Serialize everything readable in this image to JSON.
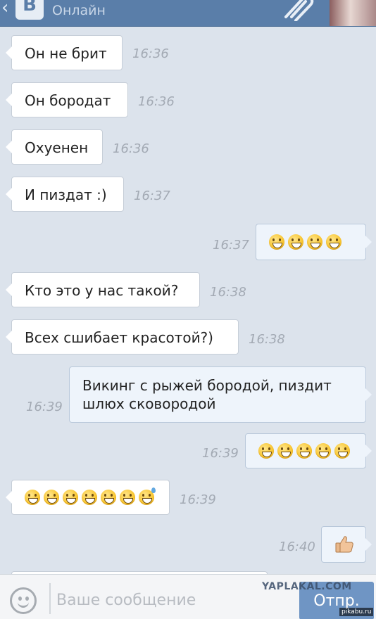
{
  "header": {
    "logo_letter": "В",
    "status": "Онлайн"
  },
  "messages": [
    {
      "direction": "in",
      "text": "Он не брит",
      "time": "16:36"
    },
    {
      "direction": "in",
      "text": "Он бородат",
      "time": "16:36"
    },
    {
      "direction": "in",
      "text": "Охуенен",
      "time": "16:36"
    },
    {
      "direction": "in",
      "text": "И пиздат :)",
      "time": "16:37"
    },
    {
      "direction": "out",
      "emoji": "😄😄😄😄",
      "time": "16:37"
    },
    {
      "direction": "in",
      "text": "Кто это у нас такой?",
      "time": "16:38"
    },
    {
      "direction": "in",
      "text": "Всех сшибает красотой?)",
      "time": "16:38"
    },
    {
      "direction": "out",
      "text_line1": "Викинг с рыжей бородой, пиздит",
      "text_line2": "шлюх сковородой",
      "time": "16:39"
    },
    {
      "direction": "out",
      "emoji": "😄😄😄😄😄",
      "time": "16:39"
    },
    {
      "direction": "in",
      "emoji": "😄😄😄😄😄😄😅",
      "time": "16:39"
    },
    {
      "direction": "out",
      "emoji": "👍",
      "time": "16:40"
    }
  ],
  "composer": {
    "placeholder": "Ваше сообщение",
    "send_label": "Отпр."
  },
  "watermarks": {
    "yaplakal": "YAPLAKAL.COM",
    "pikabu": "pikabu.ru"
  },
  "colors": {
    "header": "#5a7ea9",
    "background": "#dce3ec",
    "outgoing_bubble": "#eef4fb",
    "incoming_bubble": "#ffffff",
    "send_button": "#6f95c4"
  }
}
